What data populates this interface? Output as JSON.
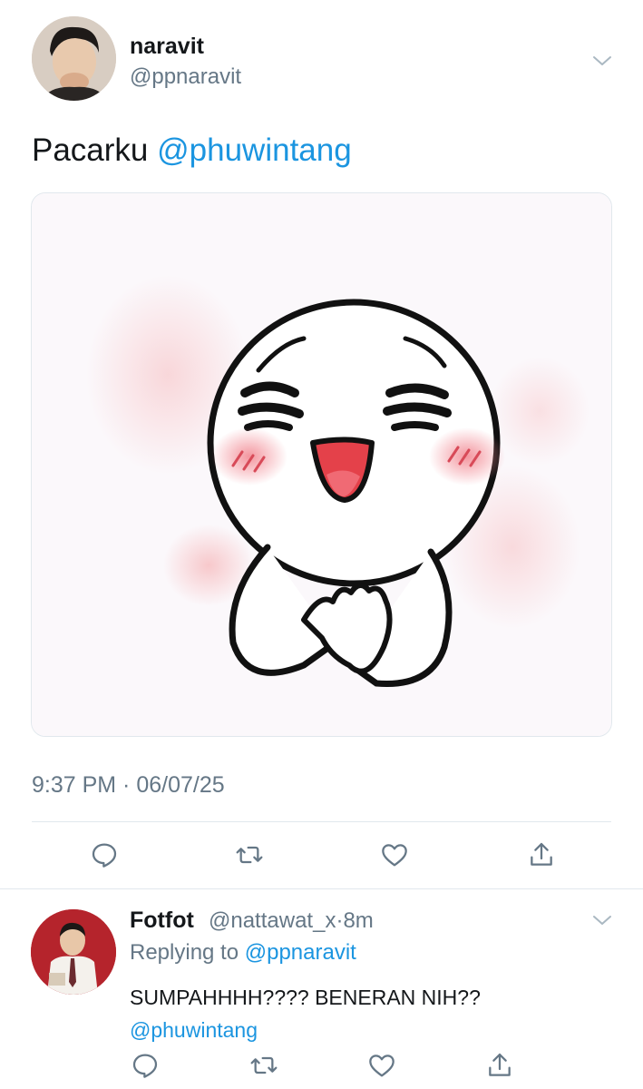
{
  "tweet": {
    "display_name": "naravit",
    "handle": "@ppnaravit",
    "text_prefix": "Pacarku ",
    "text_mention": "@phuwintang",
    "timestamp": "9:37 PM · 06/07/25",
    "media": {
      "description_icon": "blushing-smiley-sticker"
    }
  },
  "reply": {
    "display_name": "Fotfot",
    "handle": "@nattawat_x",
    "separator": "·",
    "age": "8m",
    "replying_to_label": "Replying to ",
    "replying_to_mention": "@ppnaravit",
    "text_line1": "SUMPAHHHH???? BENERAN NIH??",
    "text_mention": "@phuwintang"
  },
  "actions": {
    "icons": [
      "reply-icon",
      "retweet-icon",
      "like-icon",
      "share-icon"
    ]
  },
  "colors": {
    "link": "#1b95e0",
    "secondary_text": "#657786",
    "divider": "#e1e8ed",
    "icon": "#657786"
  }
}
